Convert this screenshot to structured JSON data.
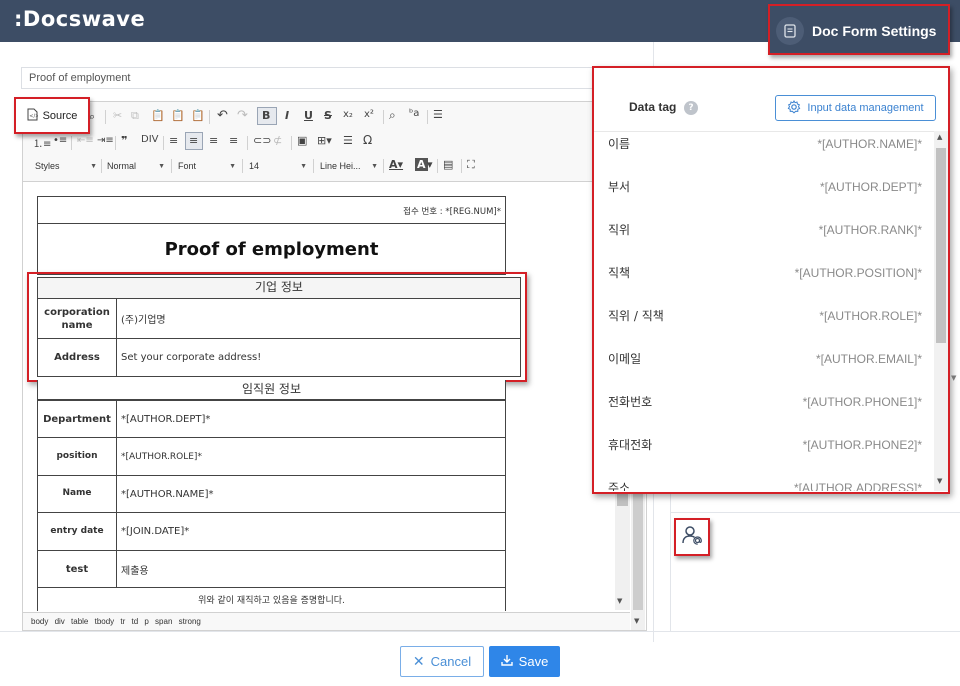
{
  "app": {
    "logo": ":Docswave"
  },
  "header": {
    "settings_label": "Doc Form Settings",
    "settings_icon": "document-icon"
  },
  "title_input": {
    "value": "Proof of employment"
  },
  "editor": {
    "source_label": "Source",
    "combos": {
      "styles": "Styles",
      "format": "Normal",
      "font": "Font",
      "size": "14",
      "line_height": "Line Hei..."
    },
    "statusbar": "body div table tbody tr td p span strong"
  },
  "document": {
    "reg_num": "접수 번호 : *[REG.NUM]*",
    "title": "Proof of employment",
    "company_section": "기업 정보",
    "company_rows": [
      {
        "label": "corporation name",
        "value": "(주)기업명"
      },
      {
        "label": "Address",
        "value": "Set your corporate address!"
      }
    ],
    "employee_section": "임직원 정보",
    "employee_rows": [
      {
        "label": "Department",
        "value": "*[AUTHOR.DEPT]*"
      },
      {
        "label": "position",
        "value": "*[AUTHOR.ROLE]*"
      },
      {
        "label": "Name",
        "value": "*[AUTHOR.NAME]*"
      },
      {
        "label": "entry date",
        "value": "*[JOIN.DATE]*"
      },
      {
        "label": "test",
        "value": "제출용"
      }
    ],
    "footer": "위와 같이 재직하고 있음을 증명합니다."
  },
  "datatag": {
    "title": "Data tag",
    "help": "?",
    "input_mgmt_label": "Input data management",
    "rows": [
      {
        "name": "이름",
        "tag": "*[AUTHOR.NAME]*"
      },
      {
        "name": "부서",
        "tag": "*[AUTHOR.DEPT]*"
      },
      {
        "name": "직위",
        "tag": "*[AUTHOR.RANK]*"
      },
      {
        "name": "직책",
        "tag": "*[AUTHOR.POSITION]*"
      },
      {
        "name": "직위 / 직책",
        "tag": "*[AUTHOR.ROLE]*"
      },
      {
        "name": "이메일",
        "tag": "*[AUTHOR.EMAIL]*"
      },
      {
        "name": "전화번호",
        "tag": "*[AUTHOR.PHONE1]*"
      },
      {
        "name": "휴대전화",
        "tag": "*[AUTHOR.PHONE2]*"
      },
      {
        "name": "주소",
        "tag": "*[AUTHOR.ADDRESS]*"
      }
    ]
  },
  "footer_buttons": {
    "cancel": "Cancel",
    "save": "Save"
  },
  "colors": {
    "header_bg": "#3d4d65",
    "highlight": "#d41f26",
    "primary": "#2f86e8"
  }
}
